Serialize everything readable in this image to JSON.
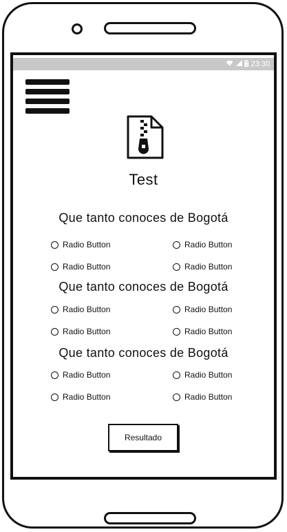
{
  "status_bar": {
    "time": "23:30",
    "icons": [
      "wifi-icon",
      "signal-icon",
      "battery-icon"
    ]
  },
  "app": {
    "title": "Test",
    "icon": "zip-file-icon",
    "menu_icon": "hamburger-menu-icon"
  },
  "questions": [
    {
      "text": "Que tanto conoces de Bogotá",
      "options": [
        "Radio Button",
        "Radio Button",
        "Radio Button",
        "Radio Button"
      ]
    },
    {
      "text": "Que tanto conoces de Bogotá",
      "options": [
        "Radio Button",
        "Radio Button",
        "Radio Button",
        "Radio Button"
      ]
    },
    {
      "text": "Que tanto conoces de Bogotá",
      "options": [
        "Radio Button",
        "Radio Button",
        "Radio Button",
        "Radio Button"
      ]
    }
  ],
  "result_button": {
    "label": "Resultado"
  },
  "colors": {
    "stroke": "#111111",
    "status_bar": "#c8c8c8",
    "background": "#ffffff"
  }
}
